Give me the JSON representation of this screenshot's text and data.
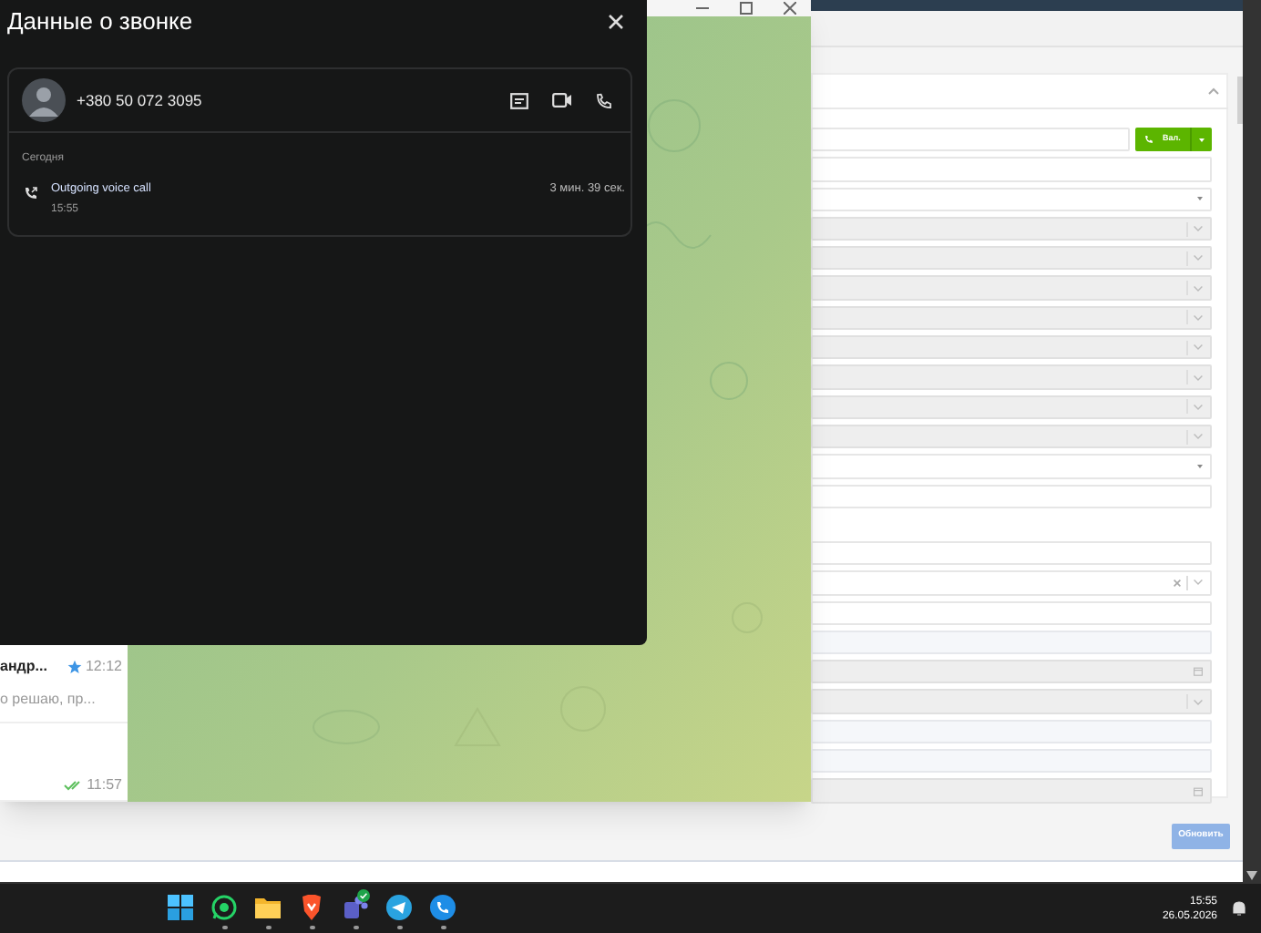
{
  "call_dialog": {
    "title": "Данные о звонке",
    "phone": "+380 50 072 3095",
    "section": "Сегодня",
    "calls": [
      {
        "kind": "outgoing",
        "label": "Outgoing voice call",
        "time": "15:55",
        "duration": "3 мин. 39 сек."
      }
    ]
  },
  "chat_list": [
    {
      "name": "андр...",
      "starred": true,
      "time": "12:12",
      "preview": "о решаю, пр..."
    },
    {
      "time": "11:57",
      "read": true
    }
  ],
  "crm": {
    "call_button": "Вал.",
    "fields_top": [
      {
        "kind": "input",
        "disabled": false
      },
      {
        "kind": "input",
        "disabled": false
      },
      {
        "kind": "select",
        "disabled": false
      },
      {
        "kind": "select",
        "disabled": true
      },
      {
        "kind": "select",
        "disabled": true
      },
      {
        "kind": "select",
        "disabled": true
      },
      {
        "kind": "select",
        "disabled": true
      },
      {
        "kind": "select",
        "disabled": true
      },
      {
        "kind": "select",
        "disabled": true
      },
      {
        "kind": "select",
        "disabled": true
      },
      {
        "kind": "select",
        "disabled": true
      },
      {
        "kind": "select",
        "disabled": false
      },
      {
        "kind": "input",
        "disabled": false
      }
    ],
    "fields_bottom": [
      {
        "kind": "input",
        "disabled": false
      },
      {
        "kind": "clearable",
        "disabled": false
      },
      {
        "kind": "input",
        "disabled": false
      },
      {
        "kind": "readonly",
        "disabled": false
      },
      {
        "kind": "date",
        "disabled": true
      },
      {
        "kind": "select",
        "disabled": true
      },
      {
        "kind": "readonly",
        "disabled": false
      },
      {
        "kind": "readonly",
        "disabled": false
      },
      {
        "kind": "date",
        "disabled": true
      }
    ],
    "submit": "Обновить"
  },
  "taskbar": {
    "apps": [
      {
        "kind": "start",
        "running": false
      },
      {
        "kind": "whatsapp",
        "running": true
      },
      {
        "kind": "files",
        "running": true
      },
      {
        "kind": "browser",
        "running": true
      },
      {
        "kind": "teams",
        "running": true
      },
      {
        "kind": "telegram",
        "running": true
      },
      {
        "kind": "phone",
        "running": true
      }
    ],
    "time": "15:55",
    "date": "26.05.2026"
  }
}
